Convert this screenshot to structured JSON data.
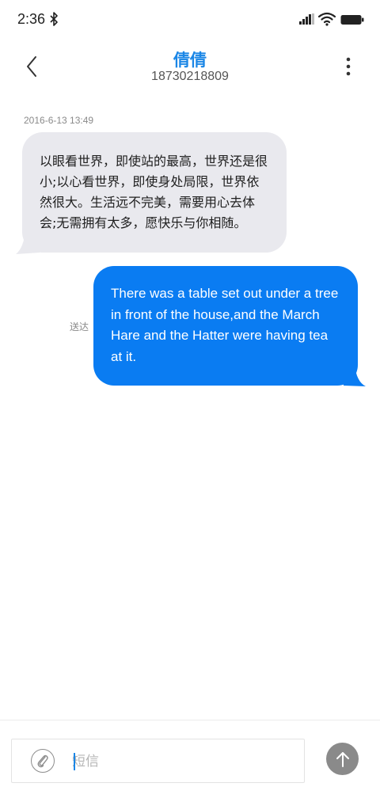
{
  "status_bar": {
    "time": "2:36",
    "icons": [
      "bluetooth-icon",
      "signal-icon",
      "wifi-icon",
      "battery-icon"
    ]
  },
  "header": {
    "contact_name": "倩倩",
    "contact_number": "18730218809",
    "icons": [
      "back-arrow-icon",
      "more-vert-icon"
    ]
  },
  "conversation": {
    "timestamp": "2016-6-13 13:49",
    "incoming_message": "以眼看世界，即使站的最高，世界还是很小;以心看世界，即使身处局限，世界依然很大。生活远不完美，需要用心去体会;无需拥有太多，愿快乐与你相随。",
    "outgoing_message": "There was a table set out under a tree in front of the house,and the March Hare and the Hatter were having tea at it.",
    "delivered_label": "送达"
  },
  "composer": {
    "placeholder": "短信",
    "icons": [
      "attachment-icon",
      "send-arrow-icon"
    ]
  },
  "colors": {
    "accent": "#1a86e6",
    "outgoing_bubble": "#0a7cf2",
    "incoming_bubble": "#e9e9ee",
    "send_button": "#8a8a8a"
  }
}
